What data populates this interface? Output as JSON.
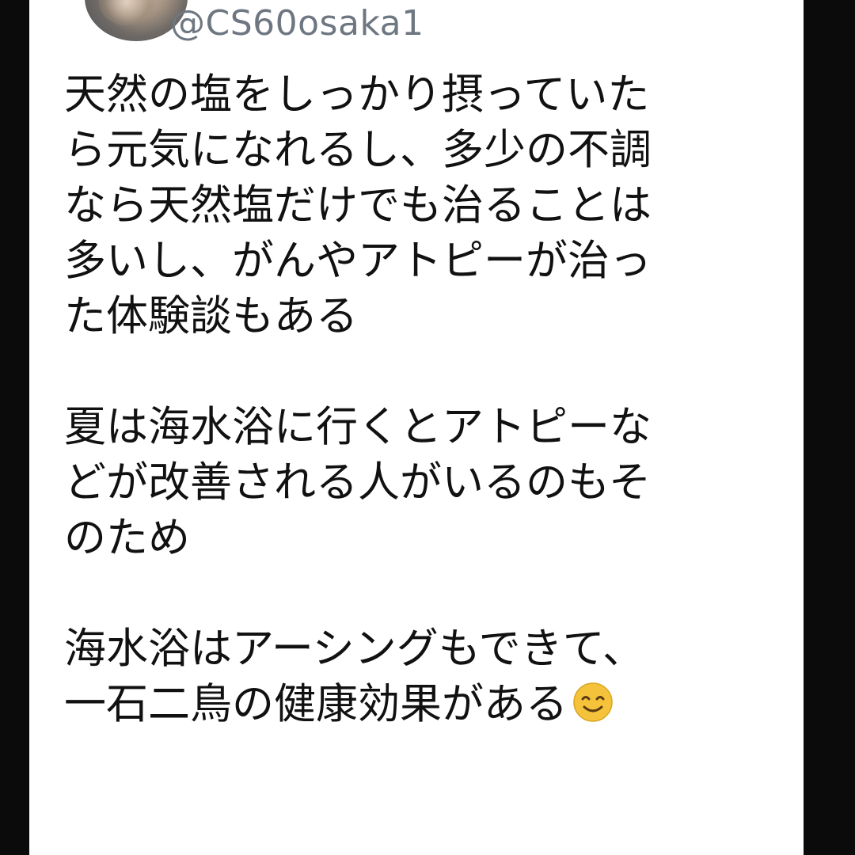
{
  "tweet": {
    "handle": "@CS60osaka1",
    "paragraphs": [
      {
        "lines": [
          "天然の塩をしっかり摂っていた",
          "ら元気になれるし、多少の不調",
          "なら天然塩だけでも治ることは",
          "多いし、がんやアトピーが治っ",
          "た体験談もある"
        ]
      },
      {
        "lines": [
          "夏は海水浴に行くとアトピーな",
          "どが改善される人がいるのもそ",
          "のため"
        ]
      },
      {
        "lines": [
          "海水浴はアーシングもできて、",
          "一石二鳥の健康効果がある"
        ]
      }
    ],
    "trailing_emoji": "smiling-face-emoji"
  },
  "colors": {
    "background": "#0b0b0b",
    "card": "#ffffff",
    "text": "#111111",
    "handle": "#6e7781",
    "emoji": "#f5c33b"
  }
}
